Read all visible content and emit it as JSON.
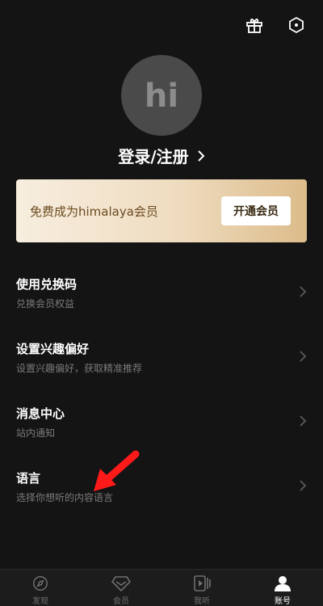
{
  "header": {
    "icons": [
      "gift-icon",
      "settings-hexagon-icon"
    ]
  },
  "profile": {
    "avatar_text": "hi",
    "login_label": "登录/注册"
  },
  "vip": {
    "text": "免费成为himalaya会员",
    "button": "开通会员"
  },
  "menu": [
    {
      "title": "使用兑换码",
      "subtitle": "兑换会员权益"
    },
    {
      "title": "设置兴趣偏好",
      "subtitle": "设置兴趣偏好，获取精准推荐"
    },
    {
      "title": "消息中心",
      "subtitle": "站内通知"
    },
    {
      "title": "语言",
      "subtitle": "选择你想听的内容语言"
    }
  ],
  "tabs": [
    {
      "label": "发现",
      "icon": "compass-icon"
    },
    {
      "label": "会员",
      "icon": "diamond-icon"
    },
    {
      "label": "我听",
      "icon": "play-cards-icon"
    },
    {
      "label": "账号",
      "icon": "user-icon",
      "active": true
    }
  ],
  "colors": {
    "background": "#141414",
    "annotation_arrow": "#ff1a1a",
    "vip_gold": "#dcbc8a"
  }
}
